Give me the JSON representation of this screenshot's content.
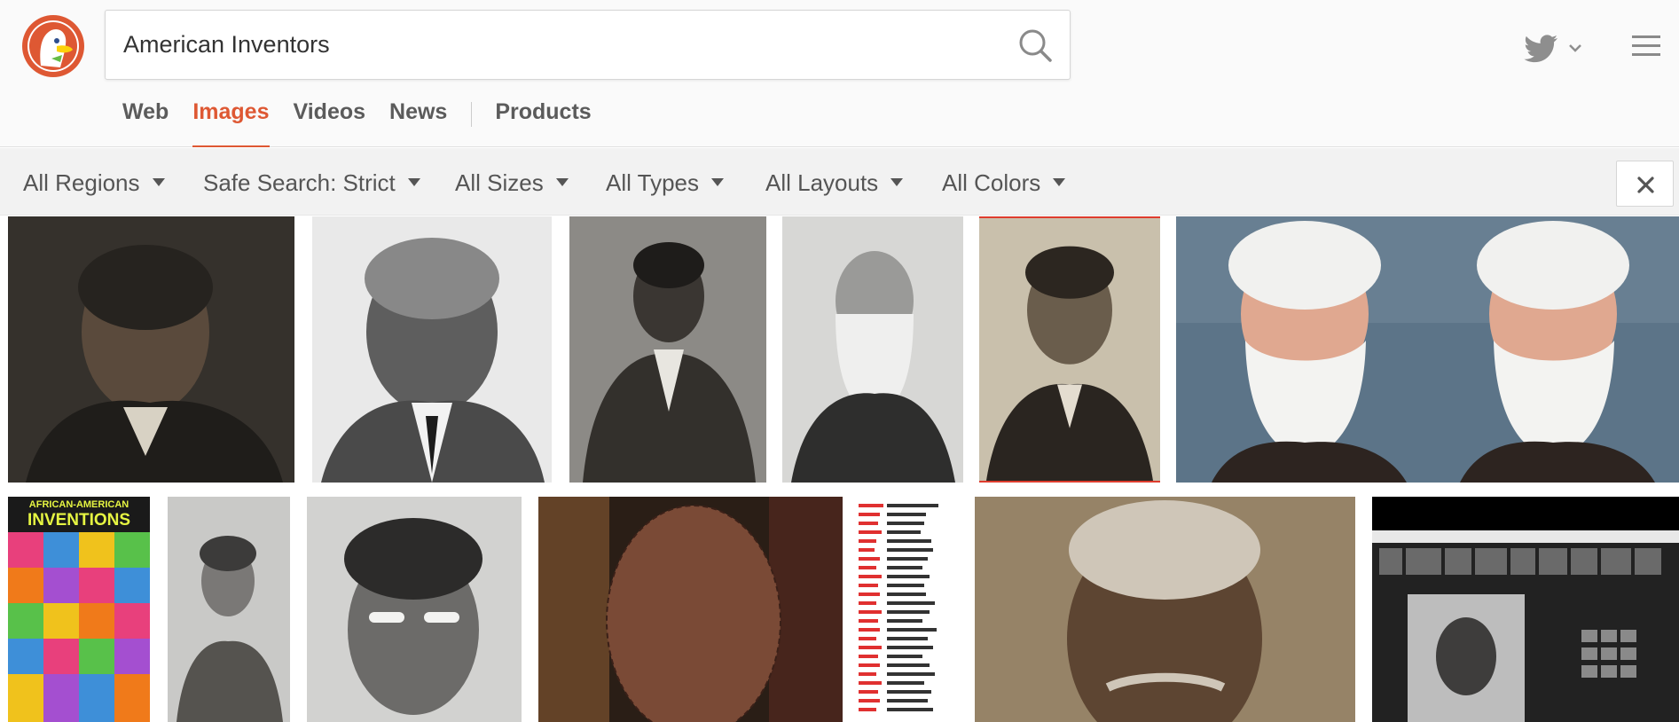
{
  "search": {
    "query": "American Inventors"
  },
  "tabs": [
    {
      "label": "Web",
      "active": false
    },
    {
      "label": "Images",
      "active": true
    },
    {
      "label": "Videos",
      "active": false
    },
    {
      "label": "News",
      "active": false
    },
    {
      "label": "Products",
      "active": false
    }
  ],
  "filters": {
    "regions": "All Regions",
    "safe_search": "Safe Search: Strict",
    "sizes": "All Sizes",
    "types": "All Types",
    "layouts": "All Layouts",
    "colors": "All Colors"
  },
  "poster": {
    "title_line1": "AFRICAN-AMERICAN",
    "title_line2": "INVENTIONS"
  },
  "accent_color": "#de5833",
  "icons": [
    "duckduckgo-logo",
    "search-icon",
    "twitter-icon",
    "chevron-down-icon",
    "hamburger-menu-icon",
    "close-icon"
  ]
}
